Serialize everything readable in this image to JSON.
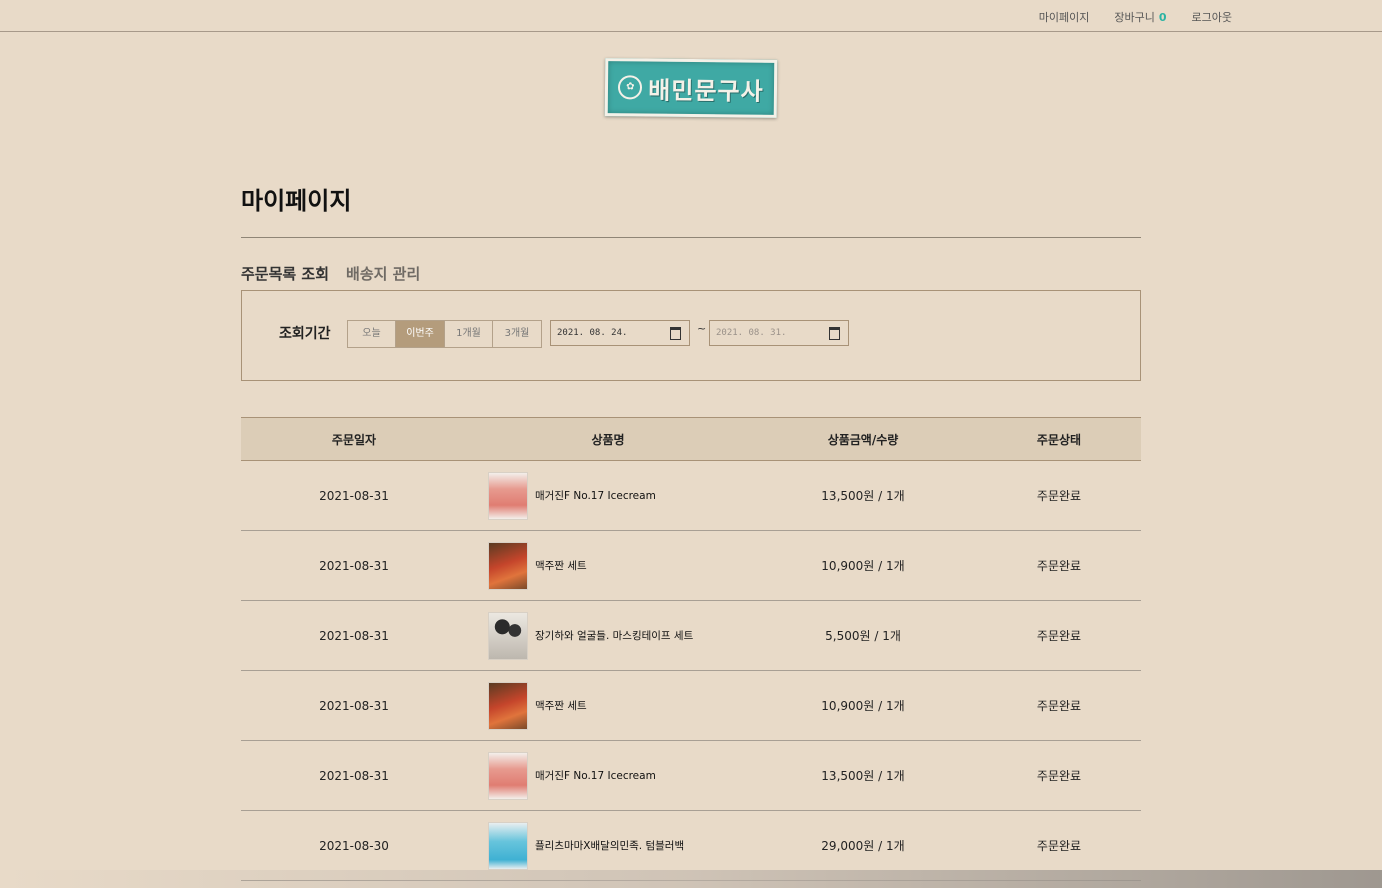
{
  "topnav": {
    "mypage": "마이페이지",
    "cart": "장바구니",
    "cart_count": "0",
    "logout": "로그아웃"
  },
  "brand": {
    "logo_text": "배민문구사",
    "logo_icon": "b-seal-icon"
  },
  "page": {
    "title": "마이페이지"
  },
  "tabs": [
    {
      "label": "주문목록 조회",
      "active": true
    },
    {
      "label": "배송지 관리",
      "active": false
    }
  ],
  "filter": {
    "label": "조회기간",
    "periods": [
      {
        "label": "오늘",
        "active": false
      },
      {
        "label": "이번주",
        "active": true
      },
      {
        "label": "1개월",
        "active": false
      },
      {
        "label": "3개월",
        "active": false
      }
    ],
    "start_date": "2021. 08. 24.",
    "end_date": "2021. 08. 31.",
    "separator": "~"
  },
  "orders": {
    "headers": [
      "주문일자",
      "상품명",
      "상품금액/수량",
      "주문상태"
    ],
    "rows": [
      {
        "date": "2021-08-31",
        "product": "매거진F No.17 Icecream",
        "price": "13,500원 / 1개",
        "status": "주문완료",
        "thumb": "pink"
      },
      {
        "date": "2021-08-31",
        "product": "맥주짠 세트",
        "price": "10,900원 / 1개",
        "status": "주문완료",
        "thumb": "food"
      },
      {
        "date": "2021-08-31",
        "product": "장기하와 얼굴들. 마스킹테이프 세트",
        "price": "5,500원 / 1개",
        "status": "주문완료",
        "thumb": "tape"
      },
      {
        "date": "2021-08-31",
        "product": "맥주짠 세트",
        "price": "10,900원 / 1개",
        "status": "주문완료",
        "thumb": "food"
      },
      {
        "date": "2021-08-31",
        "product": "매거진F No.17 Icecream",
        "price": "13,500원 / 1개",
        "status": "주문완료",
        "thumb": "pink"
      },
      {
        "date": "2021-08-30",
        "product": "플리츠마마X배달의민족. 텀블러백",
        "price": "29,000원 / 1개",
        "status": "주문완료",
        "thumb": "blue"
      }
    ]
  }
}
